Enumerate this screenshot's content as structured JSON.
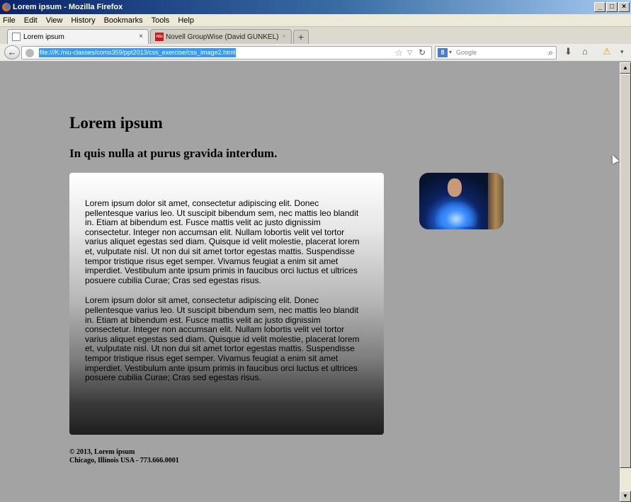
{
  "window": {
    "title": "Lorem ipsum - Mozilla Firefox",
    "buttons": {
      "minimize": "_",
      "maximize": "□",
      "close": "×"
    }
  },
  "menu": [
    "File",
    "Edit",
    "View",
    "History",
    "Bookmarks",
    "Tools",
    "Help"
  ],
  "tabs": [
    {
      "label": "Lorem ipsum",
      "active": true,
      "close": "×"
    },
    {
      "label": "Novell GroupWise (David GUNKEL)",
      "active": false,
      "close": "×",
      "favicon": "niu"
    }
  ],
  "new_tab_label": "+",
  "nav": {
    "back_icon": "back-arrow-icon",
    "url": "file:///K:/niu-classes/coms359/ppt2013/css_exercise/css_image2.html",
    "search_engine_letter": "8",
    "search_placeholder": "Google"
  },
  "page": {
    "h1": "Lorem ipsum",
    "h2": "In quis nulla at purus gravida interdum.",
    "paragraphs": [
      "Lorem ipsum dolor sit amet, consectetur adipiscing elit. Donec pellentesque varius leo. Ut suscipit bibendum sem, nec mattis leo blandit in. Etiam at bibendum est. Fusce mattis velit ac justo dignissim consectetur. Integer non accumsan elit. Nullam lobortis velit vel tortor varius aliquet egestas sed diam. Quisque id velit molestie, placerat lorem et, vulputate nisl. Ut non dui sit amet tortor egestas mattis. Suspendisse tempor tristique risus eget semper. Vivamus feugiat a enim sit amet imperdiet. Vestibulum ante ipsum primis in faucibus orci luctus et ultrices posuere cubilia Curae; Cras sed egestas risus.",
      "Lorem ipsum dolor sit amet, consectetur adipiscing elit. Donec pellentesque varius leo. Ut suscipit bibendum sem, nec mattis leo blandit in. Etiam at bibendum est. Fusce mattis velit ac justo dignissim consectetur. Integer non accumsan elit. Nullam lobortis velit vel tortor varius aliquet egestas sed diam. Quisque id velit molestie, placerat lorem et, vulputate nisl. Ut non dui sit amet tortor egestas mattis. Suspendisse tempor tristique risus eget semper. Vivamus feugiat a enim sit amet imperdiet. Vestibulum ante ipsum primis in faucibus orci luctus et ultrices posuere cubilia Curae; Cras sed egestas risus."
    ],
    "footer": {
      "line1": "© 2013, Lorem ipsum",
      "line2": "Chicago, Illinois USA - 773.666.0001"
    }
  },
  "colors": {
    "page_background": "#a3a3a3",
    "titlebar_start": "#0a246a",
    "url_highlight": "#3399ff"
  }
}
